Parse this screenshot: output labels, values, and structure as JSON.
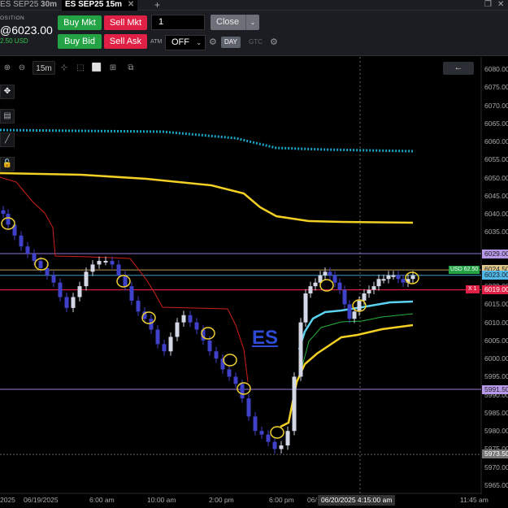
{
  "tabs": [
    {
      "label": "ES SEP25",
      "interval": "30m",
      "active": false
    },
    {
      "label": "ES SEP25",
      "interval": "15m",
      "active": true
    }
  ],
  "window": {
    "add_icon": "+",
    "restore_icon": "❐",
    "close_icon": "✕"
  },
  "position": {
    "label": "OSITION",
    "price": "@6023.00",
    "pnl": "2.50 USD"
  },
  "order_buttons": {
    "buy_mkt": "Buy Mkt",
    "sell_mkt": "Sell Mkt",
    "buy_bid": "Buy Bid",
    "sell_ask": "Sell Ask",
    "quantity": "1",
    "close": "Close",
    "atm_label": "ATM",
    "atm_value": "OFF",
    "tif_day": "DAY",
    "tif_gtc": "GTC"
  },
  "chart_toolbar": {
    "interval": "15m",
    "back_icon": "←"
  },
  "chart": {
    "symbol_label": "ES",
    "price_axis": [
      "6080.00",
      "6075.00",
      "6070.00",
      "6065.00",
      "6060.00",
      "6055.00",
      "6050.00",
      "6045.00",
      "6040.00",
      "6035.00",
      "6020.00",
      "6015.00",
      "6010.00",
      "6005.00",
      "6000.00",
      "5995.00",
      "5990.00",
      "5985.00",
      "5980.00",
      "5975.00",
      "5970.00",
      "5965.00"
    ],
    "price_labels": {
      "upper_line": "6029.00",
      "last_trade": "6024.50",
      "position": "6023.00",
      "stop": "6019.00",
      "lower_line": "5991.50",
      "low_line": "5973.50"
    },
    "position_tag": "USD 62.50",
    "stop_tag": "X 1",
    "time_axis": [
      "2025",
      "06/19/2025",
      "6:00 am",
      "10:00 am",
      "2:00 pm",
      "6:00 pm",
      "06/",
      "11:45 am"
    ],
    "crosshair_time": "06/20/2025 4:15:00 am",
    "colors": {
      "up_candle": "#d4d7e6",
      "down_candle": "#3f41c8",
      "vwap": "#f2d024",
      "upper_dotted": "#1aa6c8",
      "cyan_line": "#5ad2f0",
      "red_step": "#d0201a",
      "green_line": "#23b33a",
      "highlight_circle": "#f0d030"
    }
  }
}
